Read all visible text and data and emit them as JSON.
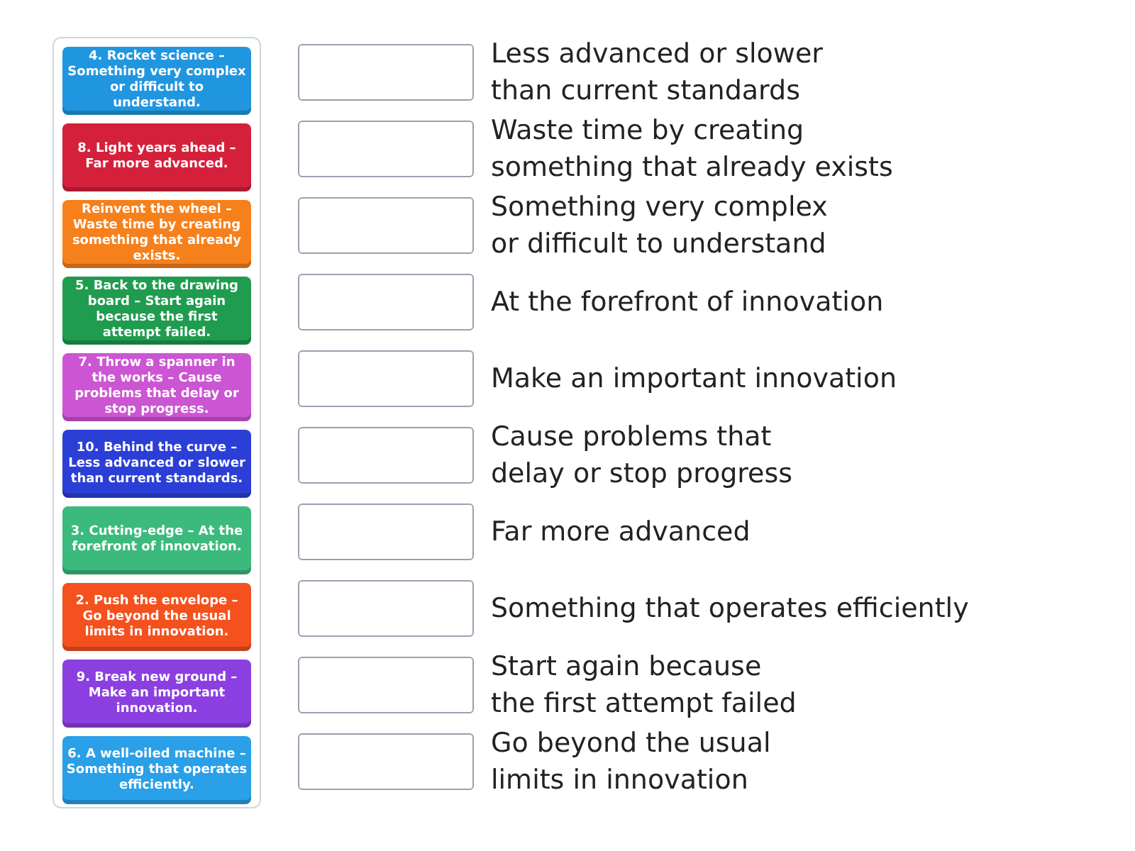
{
  "cards": [
    {
      "text": "4. Rocket science – Something very complex or difficult to understand.",
      "color": "#2196e0"
    },
    {
      "text": "8. Light years ahead – Far more advanced.",
      "color": "#d5203c"
    },
    {
      "text": "Reinvent the wheel – Waste time by creating something that already exists.",
      "color": "#f6801c"
    },
    {
      "text": "5. Back to the drawing board – Start again because the first attempt failed.",
      "color": "#1f9c4f"
    },
    {
      "text": "7. Throw a spanner in the works – Cause problems that delay or stop progress.",
      "color": "#cc55d3"
    },
    {
      "text": "10. Behind the curve – Less advanced or slower than current standards.",
      "color": "#2b3fd6"
    },
    {
      "text": "3. Cutting-edge – At the forefront of innovation.",
      "color": "#3cba7d"
    },
    {
      "text": "2. Push the envelope – Go beyond the usual limits in innovation.",
      "color": "#f4511e"
    },
    {
      "text": "9. Break new ground – Make an important innovation.",
      "color": "#8b3fe0"
    },
    {
      "text": "6. A well-oiled machine – Something that operates efficiently.",
      "color": "#29a0e8"
    }
  ],
  "definitions": [
    "Less advanced or slower\nthan current standards",
    "Waste time by creating\nsomething that already exists",
    "Something very complex\nor difficult to understand",
    "At the forefront of innovation",
    "Make an important innovation",
    "Cause problems that\ndelay or stop progress",
    "Far more advanced",
    "Something that operates efficiently",
    "Start again because\nthe first attempt failed",
    "Go beyond the usual\nlimits in innovation"
  ]
}
